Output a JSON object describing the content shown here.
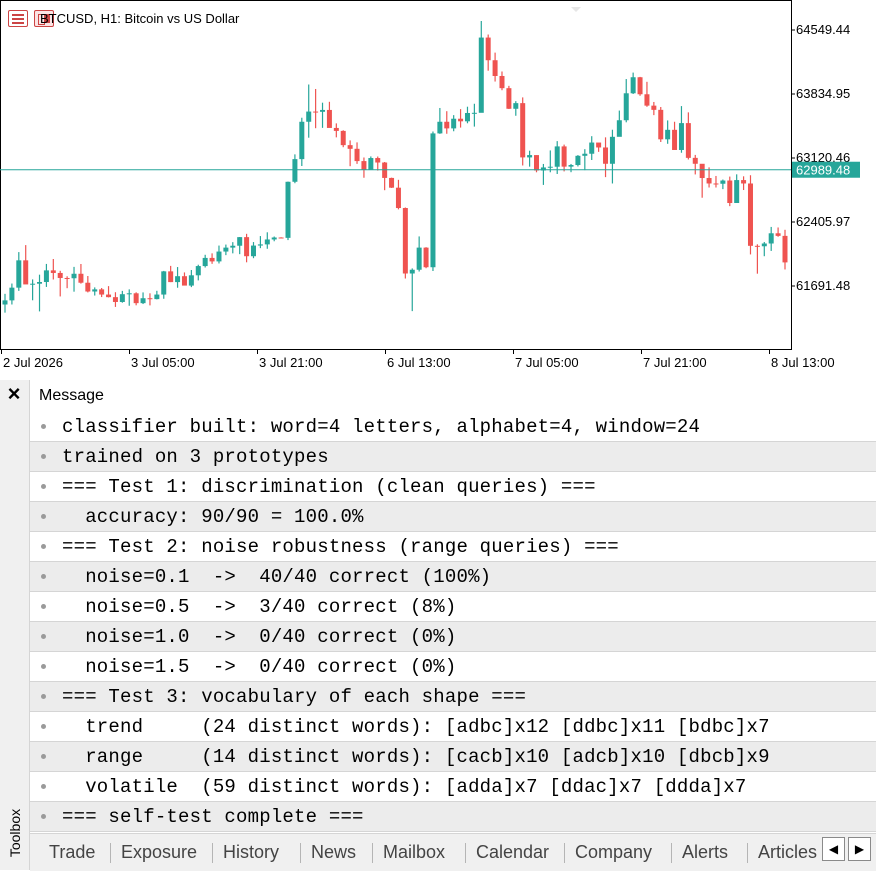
{
  "chart": {
    "symbol_title": "BTCUSD, H1:  Bitcoin vs US Dollar",
    "price_labels": [
      "64549.44",
      "63834.95",
      "63120.46",
      "62405.97",
      "61691.48"
    ],
    "current_price": "62989.48",
    "time_labels": [
      "2 Jul 2026",
      "3 Jul 05:00",
      "3 Jul 21:00",
      "6 Jul 13:00",
      "7 Jul 05:00",
      "7 Jul 21:00",
      "8 Jul 13:00"
    ],
    "colors": {
      "bull": "#26a69a",
      "bear": "#ef5350",
      "price_line": "#26a69a"
    },
    "icons": [
      "chart-list-icon",
      "chart-type-icon"
    ]
  },
  "chart_data": {
    "type": "candlestick",
    "title": "BTCUSD, H1:  Bitcoin vs US Dollar",
    "ylim": [
      61300,
      64700
    ],
    "current_price": 62989.48,
    "y_ticks": [
      64549.44,
      63834.95,
      63120.46,
      62405.97,
      61691.48
    ],
    "x_ticks": [
      "2 Jul 2026",
      "3 Jul 05:00",
      "3 Jul 21:00",
      "6 Jul 13:00",
      "7 Jul 05:00",
      "7 Jul 21:00",
      "8 Jul 13:00"
    ],
    "candles": [
      {
        "o": 61485,
        "h": 61604,
        "l": 61394,
        "c": 61531
      },
      {
        "o": 61531,
        "h": 61719,
        "l": 61485,
        "c": 61673
      },
      {
        "o": 61673,
        "h": 62070,
        "l": 61637,
        "c": 61978
      },
      {
        "o": 61978,
        "h": 62148,
        "l": 61847,
        "c": 61709
      },
      {
        "o": 61709,
        "h": 61765,
        "l": 61532,
        "c": 61717
      },
      {
        "o": 61717,
        "h": 61818,
        "l": 61408,
        "c": 61736
      },
      {
        "o": 61736,
        "h": 61938,
        "l": 61681,
        "c": 61866
      },
      {
        "o": 61866,
        "h": 61993,
        "l": 61764,
        "c": 61837
      },
      {
        "o": 61837,
        "h": 61861,
        "l": 61575,
        "c": 61781
      },
      {
        "o": 61781,
        "h": 61800,
        "l": 61667,
        "c": 61778
      },
      {
        "o": 61778,
        "h": 61905,
        "l": 61628,
        "c": 61828
      },
      {
        "o": 61828,
        "h": 61937,
        "l": 61718,
        "c": 61728
      },
      {
        "o": 61728,
        "h": 61803,
        "l": 61620,
        "c": 61630
      },
      {
        "o": 61630,
        "h": 61676,
        "l": 61585,
        "c": 61654
      },
      {
        "o": 61654,
        "h": 61669,
        "l": 61568,
        "c": 61596
      },
      {
        "o": 61596,
        "h": 61690,
        "l": 61564,
        "c": 61567
      },
      {
        "o": 61567,
        "h": 61622,
        "l": 61458,
        "c": 61513
      },
      {
        "o": 61513,
        "h": 61637,
        "l": 61505,
        "c": 61600
      },
      {
        "o": 61600,
        "h": 61654,
        "l": 61471,
        "c": 61610
      },
      {
        "o": 61610,
        "h": 61621,
        "l": 61476,
        "c": 61500
      },
      {
        "o": 61500,
        "h": 61620,
        "l": 61490,
        "c": 61555
      },
      {
        "o": 61555,
        "h": 61610,
        "l": 61475,
        "c": 61545
      },
      {
        "o": 61545,
        "h": 61638,
        "l": 61542,
        "c": 61596
      },
      {
        "o": 61596,
        "h": 61860,
        "l": 61549,
        "c": 61855
      },
      {
        "o": 61855,
        "h": 61916,
        "l": 61735,
        "c": 61735
      },
      {
        "o": 61735,
        "h": 61903,
        "l": 61672,
        "c": 61801
      },
      {
        "o": 61801,
        "h": 61843,
        "l": 61704,
        "c": 61696
      },
      {
        "o": 61696,
        "h": 61870,
        "l": 61679,
        "c": 61811
      },
      {
        "o": 61811,
        "h": 61929,
        "l": 61754,
        "c": 61914
      },
      {
        "o": 61914,
        "h": 62040,
        "l": 61898,
        "c": 62005
      },
      {
        "o": 62005,
        "h": 62056,
        "l": 61939,
        "c": 61966
      },
      {
        "o": 61966,
        "h": 62143,
        "l": 61943,
        "c": 62076
      },
      {
        "o": 62076,
        "h": 62154,
        "l": 62036,
        "c": 62120
      },
      {
        "o": 62120,
        "h": 62181,
        "l": 62056,
        "c": 62141
      },
      {
        "o": 62141,
        "h": 62238,
        "l": 62047,
        "c": 62237
      },
      {
        "o": 62237,
        "h": 62274,
        "l": 61956,
        "c": 62024
      },
      {
        "o": 62024,
        "h": 62182,
        "l": 62002,
        "c": 62143
      },
      {
        "o": 62143,
        "h": 62249,
        "l": 62114,
        "c": 62156
      },
      {
        "o": 62156,
        "h": 62291,
        "l": 62107,
        "c": 62211
      },
      {
        "o": 62211,
        "h": 62244,
        "l": 62191,
        "c": 62233
      },
      {
        "o": 62233,
        "h": 62236,
        "l": 62225,
        "c": 62229
      },
      {
        "o": 62229,
        "h": 62857,
        "l": 62204,
        "c": 62855
      },
      {
        "o": 62855,
        "h": 63161,
        "l": 62839,
        "c": 63108
      },
      {
        "o": 63108,
        "h": 63570,
        "l": 63031,
        "c": 63525
      },
      {
        "o": 63525,
        "h": 63941,
        "l": 63347,
        "c": 63639
      },
      {
        "o": 63639,
        "h": 63891,
        "l": 63453,
        "c": 63636
      },
      {
        "o": 63636,
        "h": 63738,
        "l": 63457,
        "c": 63657
      },
      {
        "o": 63657,
        "h": 63748,
        "l": 63468,
        "c": 63456
      },
      {
        "o": 63456,
        "h": 63507,
        "l": 63351,
        "c": 63423
      },
      {
        "o": 63423,
        "h": 63430,
        "l": 63241,
        "c": 63264
      },
      {
        "o": 63264,
        "h": 63317,
        "l": 63029,
        "c": 63223
      },
      {
        "o": 63223,
        "h": 63295,
        "l": 63055,
        "c": 63086
      },
      {
        "o": 63086,
        "h": 63126,
        "l": 62900,
        "c": 62989
      },
      {
        "o": 62989,
        "h": 63138,
        "l": 62988,
        "c": 63120
      },
      {
        "o": 63120,
        "h": 63137,
        "l": 62980,
        "c": 63070
      },
      {
        "o": 63070,
        "h": 63076,
        "l": 62761,
        "c": 62898
      },
      {
        "o": 62898,
        "h": 62901,
        "l": 62786,
        "c": 62789
      },
      {
        "o": 62789,
        "h": 62877,
        "l": 62547,
        "c": 62562
      },
      {
        "o": 62562,
        "h": 62568,
        "l": 61775,
        "c": 61831
      },
      {
        "o": 61831,
        "h": 61888,
        "l": 61411,
        "c": 61873
      },
      {
        "o": 61873,
        "h": 62245,
        "l": 61853,
        "c": 62120
      },
      {
        "o": 62120,
        "h": 62125,
        "l": 61890,
        "c": 61901
      },
      {
        "o": 61901,
        "h": 63416,
        "l": 61859,
        "c": 63395
      },
      {
        "o": 63395,
        "h": 63679,
        "l": 63390,
        "c": 63525
      },
      {
        "o": 63525,
        "h": 63643,
        "l": 63391,
        "c": 63451
      },
      {
        "o": 63451,
        "h": 63599,
        "l": 63419,
        "c": 63559
      },
      {
        "o": 63559,
        "h": 63666,
        "l": 63460,
        "c": 63530
      },
      {
        "o": 63530,
        "h": 63693,
        "l": 63508,
        "c": 63623
      },
      {
        "o": 63623,
        "h": 63726,
        "l": 63471,
        "c": 63625
      },
      {
        "o": 63625,
        "h": 64650,
        "l": 63642,
        "c": 64465
      },
      {
        "o": 64465,
        "h": 64499,
        "l": 64095,
        "c": 64212
      },
      {
        "o": 64212,
        "h": 64297,
        "l": 63974,
        "c": 64036
      },
      {
        "o": 64036,
        "h": 64086,
        "l": 63877,
        "c": 63900
      },
      {
        "o": 63900,
        "h": 63926,
        "l": 63668,
        "c": 63670
      },
      {
        "o": 63670,
        "h": 63755,
        "l": 63592,
        "c": 63733
      },
      {
        "o": 63733,
        "h": 63797,
        "l": 63037,
        "c": 63127
      },
      {
        "o": 63127,
        "h": 63202,
        "l": 63024,
        "c": 63153
      },
      {
        "o": 63153,
        "h": 63151,
        "l": 62961,
        "c": 62981
      },
      {
        "o": 62981,
        "h": 63054,
        "l": 62820,
        "c": 63015
      },
      {
        "o": 63015,
        "h": 63205,
        "l": 62961,
        "c": 63023
      },
      {
        "o": 63023,
        "h": 63309,
        "l": 62942,
        "c": 63250
      },
      {
        "o": 63250,
        "h": 63270,
        "l": 62971,
        "c": 63024
      },
      {
        "o": 63024,
        "h": 63054,
        "l": 62962,
        "c": 63042
      },
      {
        "o": 63042,
        "h": 63153,
        "l": 63026,
        "c": 63145
      },
      {
        "o": 63145,
        "h": 63219,
        "l": 62985,
        "c": 63168
      },
      {
        "o": 63168,
        "h": 63364,
        "l": 63098,
        "c": 63293
      },
      {
        "o": 63293,
        "h": 63287,
        "l": 63189,
        "c": 63238
      },
      {
        "o": 63238,
        "h": 63351,
        "l": 62907,
        "c": 63056
      },
      {
        "o": 63056,
        "h": 63436,
        "l": 62836,
        "c": 63357
      },
      {
        "o": 63357,
        "h": 63650,
        "l": 63384,
        "c": 63542
      },
      {
        "o": 63542,
        "h": 64002,
        "l": 63519,
        "c": 63843
      },
      {
        "o": 63843,
        "h": 64074,
        "l": 63835,
        "c": 64022
      },
      {
        "o": 64022,
        "h": 64026,
        "l": 63815,
        "c": 63832
      },
      {
        "o": 63832,
        "h": 63971,
        "l": 63692,
        "c": 63705
      },
      {
        "o": 63705,
        "h": 63746,
        "l": 63599,
        "c": 63658
      },
      {
        "o": 63658,
        "h": 63690,
        "l": 63299,
        "c": 63329
      },
      {
        "o": 63329,
        "h": 63540,
        "l": 63279,
        "c": 63435
      },
      {
        "o": 63435,
        "h": 63525,
        "l": 63218,
        "c": 63210
      },
      {
        "o": 63210,
        "h": 63700,
        "l": 63179,
        "c": 63510
      },
      {
        "o": 63510,
        "h": 63630,
        "l": 63104,
        "c": 63122
      },
      {
        "o": 63122,
        "h": 63155,
        "l": 62937,
        "c": 63056
      },
      {
        "o": 63056,
        "h": 63023,
        "l": 62677,
        "c": 62897
      },
      {
        "o": 62897,
        "h": 63016,
        "l": 62791,
        "c": 62836
      },
      {
        "o": 62836,
        "h": 62920,
        "l": 62791,
        "c": 62833
      },
      {
        "o": 62833,
        "h": 62880,
        "l": 62773,
        "c": 62869
      },
      {
        "o": 62869,
        "h": 62913,
        "l": 62583,
        "c": 62618
      },
      {
        "o": 62618,
        "h": 62938,
        "l": 62632,
        "c": 62874
      },
      {
        "o": 62874,
        "h": 62916,
        "l": 62763,
        "c": 62836
      },
      {
        "o": 62836,
        "h": 62928,
        "l": 62044,
        "c": 62140
      },
      {
        "o": 62140,
        "h": 62157,
        "l": 61829,
        "c": 62135
      },
      {
        "o": 62135,
        "h": 62183,
        "l": 62024,
        "c": 62166
      },
      {
        "o": 62166,
        "h": 62351,
        "l": 62083,
        "c": 62280
      },
      {
        "o": 62280,
        "h": 62345,
        "l": 62241,
        "c": 62251
      },
      {
        "o": 62251,
        "h": 62319,
        "l": 61876,
        "c": 61955
      }
    ]
  },
  "toolbox": {
    "label": "Toolbox",
    "close_icon": "×",
    "column_header": "Message",
    "messages": [
      "classifier built: word=4 letters, alphabet=4, window=24",
      "trained on 3 prototypes",
      "=== Test 1: discrimination (clean queries) ===",
      "  accuracy: 90/90 = 100.0%",
      "=== Test 2: noise robustness (range queries) ===",
      "  noise=0.1  ->  40/40 correct (100%)",
      "  noise=0.5  ->  3/40 correct (8%)",
      "  noise=1.0  ->  0/40 correct (0%)",
      "  noise=1.5  ->  0/40 correct (0%)",
      "=== Test 3: vocabulary of each shape ===",
      "  trend     (24 distinct words): [adbc]x12 [ddbc]x11 [bdbc]x7",
      "  range     (14 distinct words): [cacb]x10 [adcb]x10 [dbcb]x9",
      "  volatile  (59 distinct words): [adda]x7 [ddac]x7 [ddda]x7",
      "=== self-test complete ==="
    ],
    "tabs": [
      "Trade",
      "Exposure",
      "History",
      "News",
      "Mailbox",
      "Calendar",
      "Company",
      "Alerts",
      "Articles"
    ],
    "scroll_left": "◀",
    "scroll_right": "▶"
  }
}
